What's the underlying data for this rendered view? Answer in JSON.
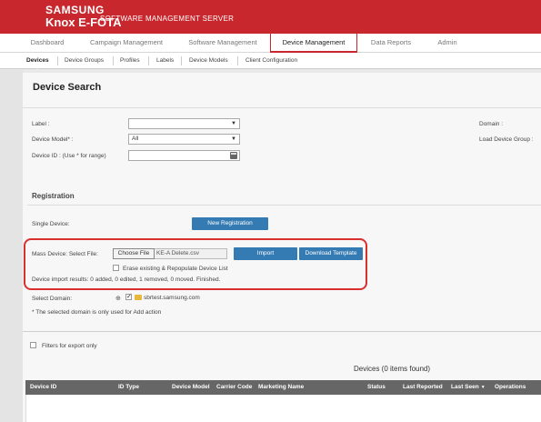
{
  "brand": {
    "line1": "SAMSUNG",
    "line2": "Knox E-FOTA",
    "subtitle": "SOFTWARE MANAGEMENT SERVER"
  },
  "main_tabs": [
    {
      "label": "Dashboard"
    },
    {
      "label": "Campaign Management"
    },
    {
      "label": "Software Management"
    },
    {
      "label": "Device Management"
    },
    {
      "label": "Data Reports"
    },
    {
      "label": "Admin"
    }
  ],
  "sub_tabs": [
    {
      "label": "Devices"
    },
    {
      "label": "Device Groups"
    },
    {
      "label": "Profiles"
    },
    {
      "label": "Labels"
    },
    {
      "label": "Device Models"
    },
    {
      "label": "Client Configuration"
    }
  ],
  "search": {
    "title": "Device Search",
    "label_label": "Label :",
    "label_value": "",
    "model_label": "Device Model* :",
    "model_value": "All",
    "device_id_label": "Device ID : (Use * for range)",
    "domain_label": "Domain :",
    "load_group_label": "Load Device Group :"
  },
  "registration": {
    "title": "Registration",
    "single_label": "Single Device:",
    "new_button": "New Registration",
    "mass_label": "Mass Device: Select File:",
    "choose_file": "Choose File",
    "file_name": "KE-A Delete.csv",
    "import_button": "Import",
    "download_button": "Download Template",
    "erase_label": "Erase existing & Repopulate Device List",
    "import_results": "Device import results: 0 added, 0 edited, 1 removed, 0 moved. Finished.",
    "select_domain_label": "Select Domain:",
    "domain_name": "sbrtest.samsung.com",
    "domain_note": "* The selected domain is only used for Add action"
  },
  "filters": {
    "export_label": "Filters for export only"
  },
  "devices": {
    "count_label": "Devices (0 items found)",
    "columns": [
      "Device ID",
      "ID Type",
      "Device Model",
      "Carrier Code",
      "Marketing Name",
      "Status",
      "Last Reported",
      "Last Seen",
      "Operations"
    ]
  },
  "colors": {
    "brand_red": "#c8272d",
    "button_blue": "#357bb3",
    "highlight_red": "#d9302f",
    "table_header": "#666666"
  }
}
